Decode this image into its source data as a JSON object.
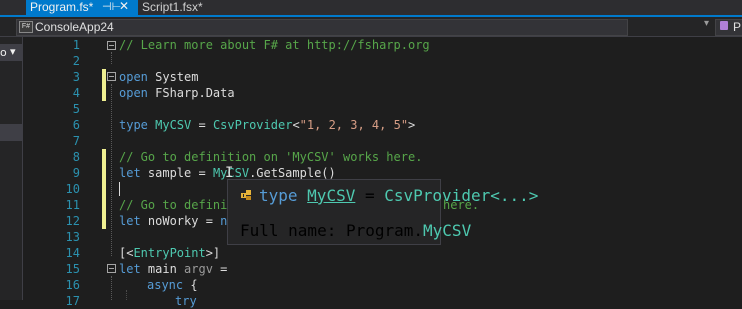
{
  "tabs": [
    {
      "label": "Program.fs*",
      "active": true
    },
    {
      "label": "Script1.fsx*",
      "active": false
    }
  ],
  "tab_pin_icon": "pin-icon",
  "tab_close_icon": "close-icon",
  "navbar": {
    "project_icon_text": "F#",
    "project_label": "ConsoleApp24",
    "right_combo_label": "P"
  },
  "left_panel": {
    "dropdown_text": "o"
  },
  "colors": {
    "keyword": "#569cd6",
    "comment": "#57a64a",
    "string": "#d69d85",
    "type": "#4ec9b0",
    "line_number": "#2b91af",
    "change_bar": "#efef91",
    "accent": "#007acc"
  },
  "editor": {
    "line_numbers": [
      "1",
      "2",
      "3",
      "4",
      "5",
      "6",
      "7",
      "8",
      "9",
      "10",
      "11",
      "12",
      "13",
      "14",
      "15",
      "16",
      "17"
    ],
    "lines": {
      "l1_comment": "// Learn more about F# at http://fsharp.org",
      "l3_kw": "open",
      "l3_rest": " System",
      "l4_kw": "open",
      "l4_rest": " FSharp.Data",
      "l6_kw": "type",
      "l6_name": " MyCSV",
      "l6_eq": " = ",
      "l6_provider": "CsvProvider",
      "l6_lt": "<",
      "l6_str": "\"1, 2, 3, 4, 5\"",
      "l6_gt": ">",
      "l8_comment": "// Go to definition on 'MyCSV' works here.",
      "l9_kw": "let",
      "l9_rest": " sample = ",
      "l9_type": "MyCSV",
      "l9_call": ".GetSample()",
      "l11_comment_a": "// Go to definit",
      "l11_comment_b": "here.",
      "l12_kw": "let",
      "l12_rest": " noWorky = ",
      "l12_partial": "ne",
      "l14_open": "[<",
      "l14_attr": "EntryPoint",
      "l14_close": ">]",
      "l15_kw": "let",
      "l15_rest": " main ",
      "l15_arg": "argv",
      "l15_eq": " =",
      "l16_kw": "async",
      "l16_rest": " {",
      "l17_partial": "try"
    }
  },
  "tooltip": {
    "icon": "class-icon",
    "kw": "type",
    "name": "MyCSV",
    "eq": " = ",
    "provider": "CsvProvider<...>",
    "fullname_label": "Full name: Program.",
    "fullname_type": "MyCSV"
  }
}
